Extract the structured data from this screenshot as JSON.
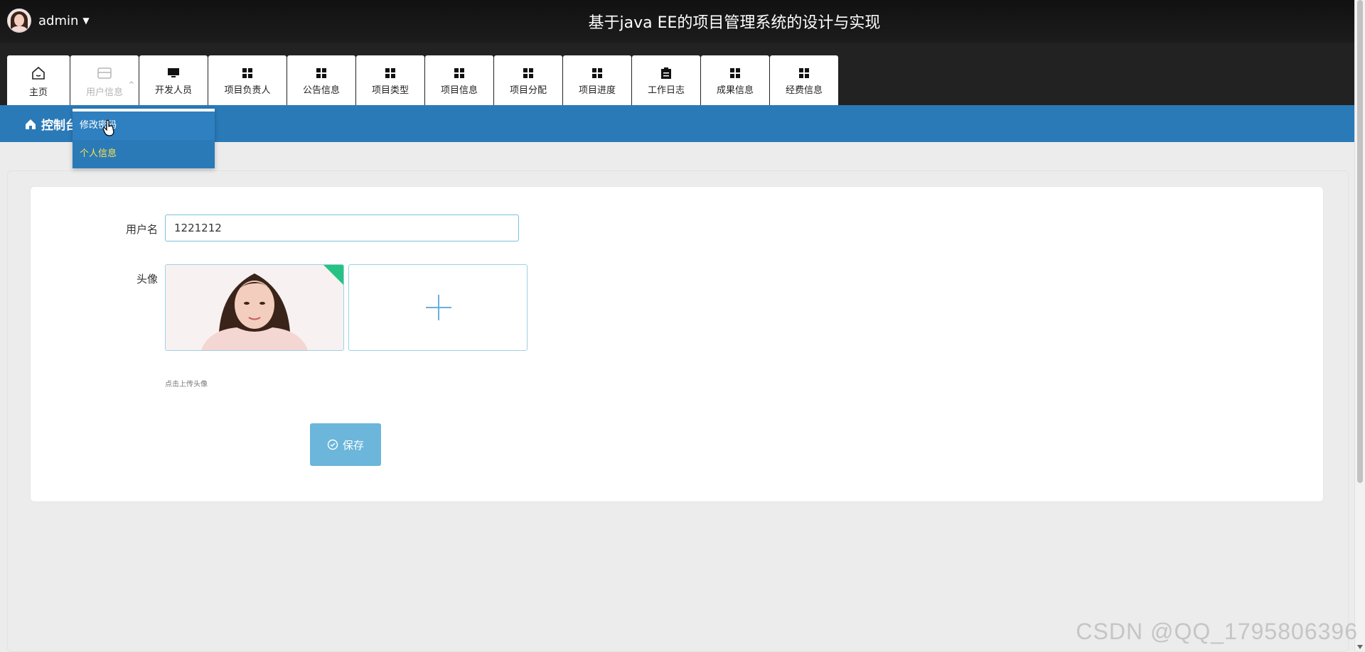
{
  "header": {
    "username": "admin",
    "title": "基于java EE的项目管理系统的设计与实现"
  },
  "nav": {
    "items": [
      {
        "label": "主页"
      },
      {
        "label": "用户信息"
      },
      {
        "label": "开发人员"
      },
      {
        "label": "项目负责人"
      },
      {
        "label": "公告信息"
      },
      {
        "label": "项目类型"
      },
      {
        "label": "项目信息"
      },
      {
        "label": "项目分配"
      },
      {
        "label": "项目进度"
      },
      {
        "label": "工作日志"
      },
      {
        "label": "成果信息"
      },
      {
        "label": "经费信息"
      }
    ]
  },
  "dropdown": {
    "items": [
      {
        "label": "修改密码"
      },
      {
        "label": "个人信息"
      }
    ]
  },
  "breadcrumb": {
    "label": "控制台"
  },
  "form": {
    "username_label": "用户名",
    "username_value": "1221212",
    "avatar_label": "头像",
    "upload_hint": "点击上传头像",
    "save_label": "保存"
  },
  "watermark": "CSDN @QQ_1795806396",
  "colors": {
    "header_bg": "#1c1c1c",
    "nav_bar_bg": "#222222",
    "blue_bar": "#2a7ab8",
    "active_dropdown_text": "#ffe24d",
    "save_button": "#6bb6da",
    "input_border": "#7cc1de",
    "badge_green": "#26c281"
  }
}
